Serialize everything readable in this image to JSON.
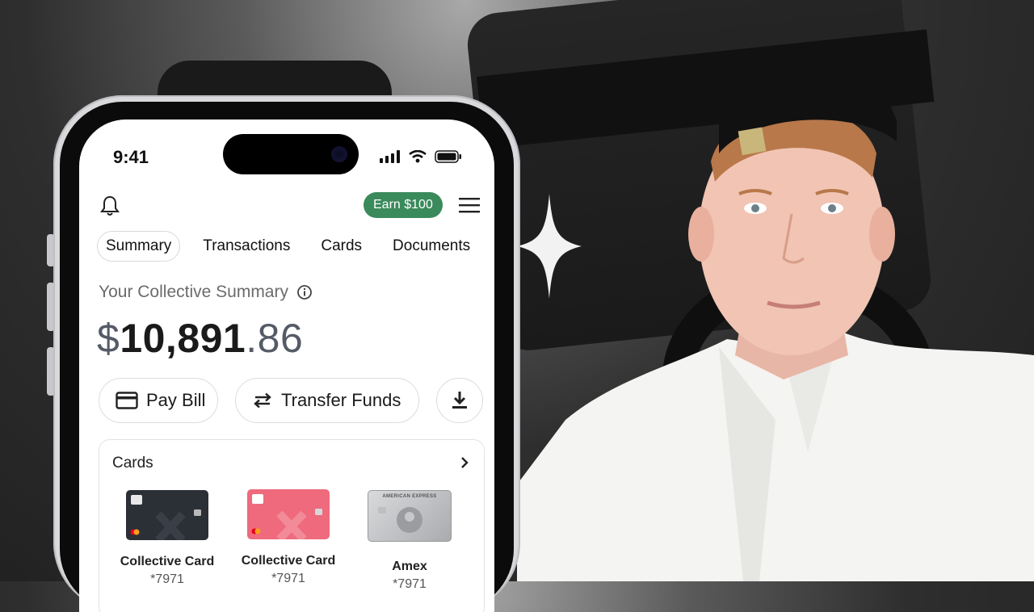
{
  "status_bar": {
    "time": "9:41"
  },
  "header": {
    "earn_label": "Earn $100",
    "accent_color": "#3a8a5c"
  },
  "tabs": [
    {
      "label": "Summary",
      "active": true
    },
    {
      "label": "Transactions",
      "active": false
    },
    {
      "label": "Cards",
      "active": false
    },
    {
      "label": "Documents",
      "active": false
    }
  ],
  "summary": {
    "title": "Your Collective Summary",
    "balance_currency": "$",
    "balance_whole": "10,891",
    "balance_cents": ".86"
  },
  "actions": {
    "pay_bill": "Pay Bill",
    "transfer_funds": "Transfer Funds"
  },
  "cards_section": {
    "title": "Cards",
    "cards": [
      {
        "name": "Collective Card",
        "number": "*7971",
        "color": "#2b2f36"
      },
      {
        "name": "Collective Card",
        "number": "*7971",
        "color": "#ee6a7c"
      },
      {
        "name": "Amex",
        "number": "*7971",
        "color": "#c9cacc",
        "logo_text": "AMERICAN EXPRESS"
      }
    ]
  }
}
